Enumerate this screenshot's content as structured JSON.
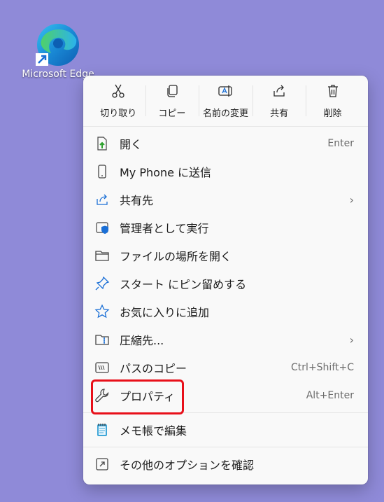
{
  "desktop_icon": {
    "label": "Microsoft Edge"
  },
  "toolbar": [
    {
      "label": "切り取り",
      "icon": "scissors-icon"
    },
    {
      "label": "コピー",
      "icon": "copy-icon"
    },
    {
      "label": "名前の変更",
      "icon": "rename-icon"
    },
    {
      "label": "共有",
      "icon": "share-icon"
    },
    {
      "label": "削除",
      "icon": "trash-icon"
    }
  ],
  "items": [
    {
      "label": "開く",
      "shortcut": "Enter",
      "icon": "open-icon"
    },
    {
      "label": "My Phone に送信",
      "shortcut": "",
      "icon": "phone-icon"
    },
    {
      "label": "共有先",
      "shortcut": "",
      "icon": "share-icon",
      "submenu": true
    },
    {
      "label": "管理者として実行",
      "shortcut": "",
      "icon": "shield-icon"
    },
    {
      "label": "ファイルの場所を開く",
      "shortcut": "",
      "icon": "folder-icon"
    },
    {
      "label": "スタート にピン留めする",
      "shortcut": "",
      "icon": "pin-icon"
    },
    {
      "label": "お気に入りに追加",
      "shortcut": "",
      "icon": "star-icon"
    },
    {
      "label": "圧縮先...",
      "shortcut": "",
      "icon": "zip-icon",
      "submenu": true
    },
    {
      "label": "パスのコピー",
      "shortcut": "Ctrl+Shift+C",
      "icon": "path-icon"
    },
    {
      "label": "プロパティ",
      "shortcut": "Alt+Enter",
      "icon": "wrench-icon",
      "highlighted": true
    }
  ],
  "notepad_item": {
    "label": "メモ帳で編集",
    "icon": "notepad-icon"
  },
  "more_item": {
    "label": "その他のオプションを確認",
    "icon": "more-options-icon"
  },
  "colors": {
    "highlight": "#e8101a",
    "desktop": "#8f8ad8"
  }
}
